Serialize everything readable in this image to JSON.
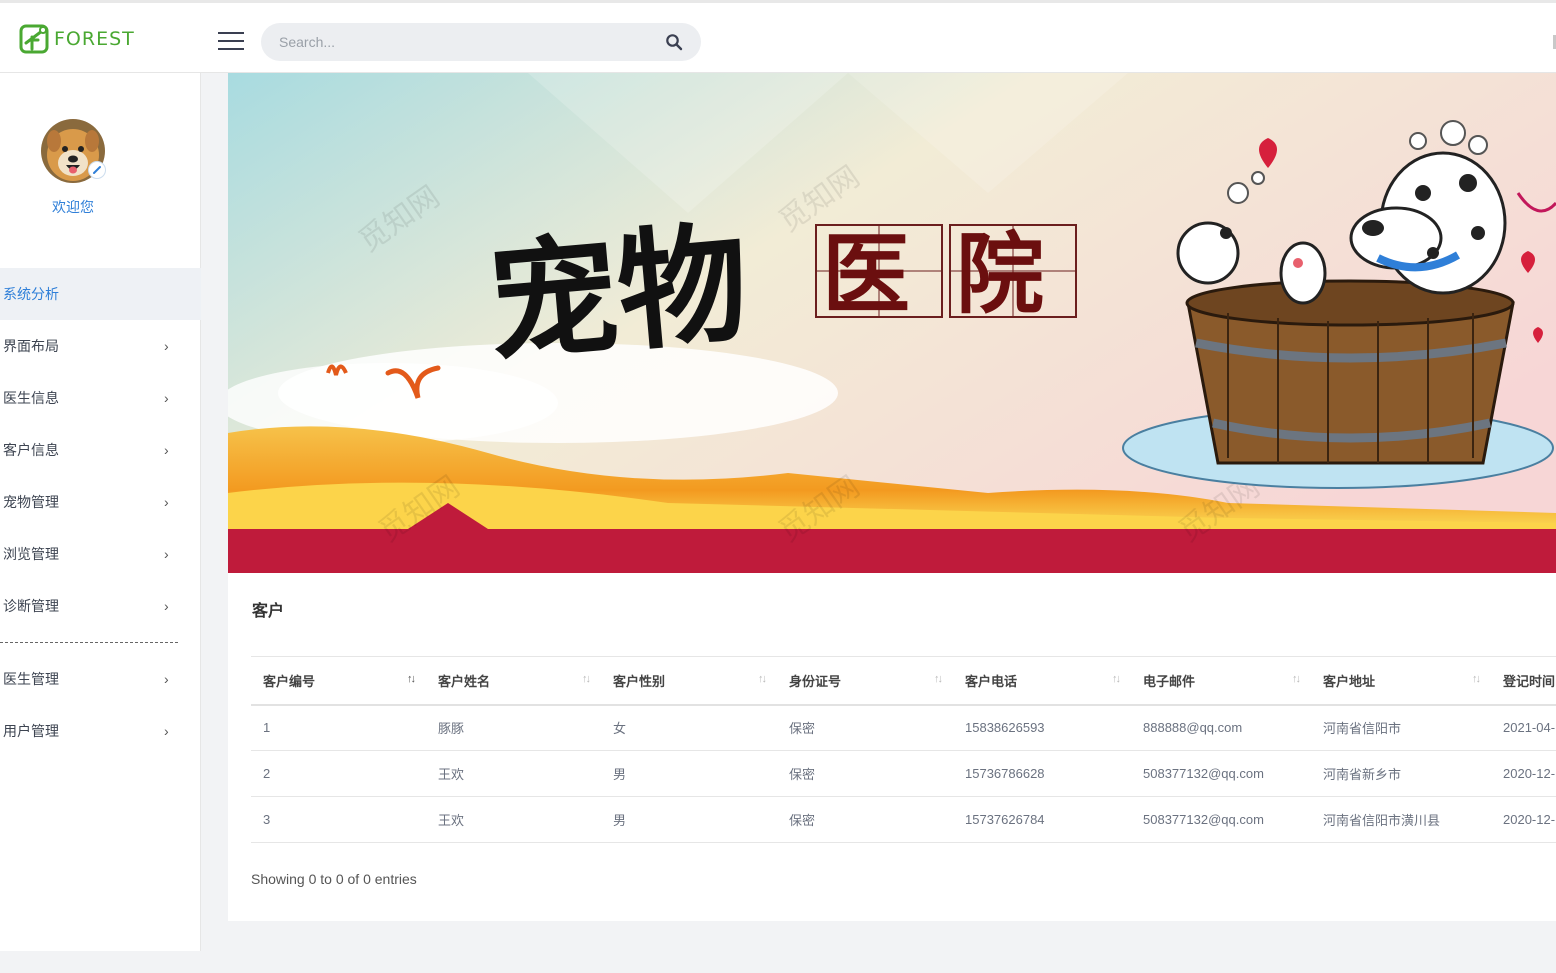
{
  "header": {
    "logo_text": "FOREST",
    "search_placeholder": "Search..."
  },
  "sidebar": {
    "welcome": "欢迎您",
    "items": [
      {
        "label": "系统分析",
        "active": true,
        "has_children": false
      },
      {
        "label": "界面布局",
        "active": false,
        "has_children": true
      },
      {
        "label": "医生信息",
        "active": false,
        "has_children": true
      },
      {
        "label": "客户信息",
        "active": false,
        "has_children": true
      },
      {
        "label": "宠物管理",
        "active": false,
        "has_children": true
      },
      {
        "label": "浏览管理",
        "active": false,
        "has_children": true
      },
      {
        "label": "诊断管理",
        "active": false,
        "has_children": true
      }
    ],
    "items_after_divider": [
      {
        "label": "医生管理",
        "has_children": true
      },
      {
        "label": "用户管理",
        "has_children": true
      }
    ]
  },
  "banner": {
    "title_brush": "宠物",
    "title_boxed": [
      "医",
      "院"
    ],
    "watermark": "觅知网"
  },
  "panel": {
    "title": "客户",
    "columns": [
      "客户编号",
      "客户姓名",
      "客户性别",
      "身份证号",
      "客户电话",
      "电子邮件",
      "客户地址",
      "登记时间"
    ],
    "rows": [
      [
        "1",
        "豚豚",
        "女",
        "保密",
        "15838626593",
        "888888@qq.com",
        "河南省信阳市",
        "2021-04-"
      ],
      [
        "2",
        "王欢",
        "男",
        "保密",
        "15736786628",
        "508377132@qq.com",
        "河南省新乡市",
        "2020-12-"
      ],
      [
        "3",
        "王欢",
        "男",
        "保密",
        "15737626784",
        "508377132@qq.com",
        "河南省信阳市潢川县",
        "2020-12-"
      ]
    ],
    "info": "Showing 0 to 0 of 0 entries"
  },
  "colors": {
    "accent": "#2f7fd8",
    "logo_green": "#4aa832",
    "banner_red": "#bf1b3b"
  }
}
